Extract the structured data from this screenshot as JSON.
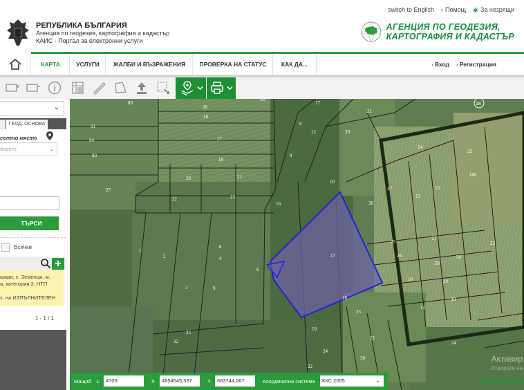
{
  "top_links": {
    "language": "switch to English",
    "help": "Помощ",
    "visually_impaired": "За незрящи"
  },
  "org": {
    "title": "РЕПУБЛИКА БЪЛГАРИЯ",
    "agency_line": "Агенция по геодезия, картография и кадастър",
    "portal_line": "КАИС - Портал за електронни услуги"
  },
  "agency_logo": {
    "line1": "АГЕНЦИЯ ПО ГЕОДЕЗИЯ,",
    "line2": "КАРТОГРАФИЯ И КАДАСТЪР"
  },
  "nav": {
    "items": [
      "КАРТА",
      "УСЛУГИ",
      "ЖАЛБИ И ВЪЗРАЖЕНИЯ",
      "ПРОВЕРКА НА СТАТУС",
      "КАК ДА..."
    ],
    "login": "Вход",
    "register": "Регистрация"
  },
  "panel": {
    "tab_geo": "ГЕОД. ОСНОВА",
    "settlement_label": "селено място",
    "settlement_placeholder": "берете",
    "search_button": "ТЪРСИ",
    "all_label": "Всички",
    "result_lines": [
      "шари, с. Земенци, м.",
      "а, категория 3, НТП",
      "",
      "х. на ИЗПЪЛНИТЕЛЕН"
    ],
    "pager": "1 - 1 / 1"
  },
  "map": {
    "scale_label": "Мащаб",
    "scale_prefix": "1:",
    "scale_value": "4703",
    "x_label": "X",
    "x_value": "4854545,537",
    "y_label": "Y",
    "y_value": "683744,667",
    "crs_label": "Координатна система",
    "crs_value": "ККС 2005",
    "watermark_1": "Активир",
    "watermark_2": "Отворете на",
    "parcel_labels": [
      "89",
      "28",
      "26",
      "17",
      "21",
      "18",
      "91",
      "8",
      "20",
      "94",
      "17",
      "12",
      "14",
      "22",
      "93",
      "18",
      "9",
      "100",
      "20",
      "21",
      "10",
      "37",
      "13",
      "27",
      "22",
      "23",
      "16",
      "36",
      "13",
      "1",
      "25",
      "27",
      "2",
      "4",
      "26",
      "17",
      "34",
      "23",
      "8",
      "28",
      "10",
      "29",
      "3",
      "9",
      "6",
      "16",
      "11",
      "30",
      "23",
      "22",
      "24",
      "22",
      "30",
      "19",
      "32",
      "24",
      "25"
    ],
    "colors": {
      "selection_fill": "#6f63a8",
      "selection_stroke": "#2323d6"
    }
  }
}
